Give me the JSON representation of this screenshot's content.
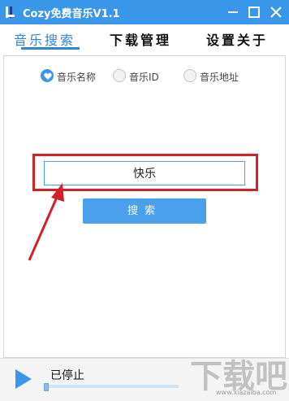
{
  "window": {
    "title": "Cozy免费音乐V1.1",
    "accent_color": "#3a96e8",
    "controls": [
      "minimize-icon",
      "maximize-icon",
      "close-icon"
    ]
  },
  "tabs": [
    {
      "label": "音乐搜索",
      "active": true
    },
    {
      "label": "下载管理",
      "active": false
    },
    {
      "label": "设置关于",
      "active": false
    }
  ],
  "search": {
    "options": [
      {
        "label": "音乐名称",
        "selected": true,
        "icon": "heart-icon"
      },
      {
        "label": "音乐ID",
        "selected": false
      },
      {
        "label": "音乐地址",
        "selected": false
      }
    ],
    "input_value": "快乐",
    "button_label": "搜索",
    "highlight_color": "#d4202a"
  },
  "player": {
    "status": "已停止",
    "progress": 0.0,
    "play_icon": "play-icon"
  },
  "watermark": {
    "logo": "下载吧",
    "site": "www.xiazaiba.com"
  }
}
